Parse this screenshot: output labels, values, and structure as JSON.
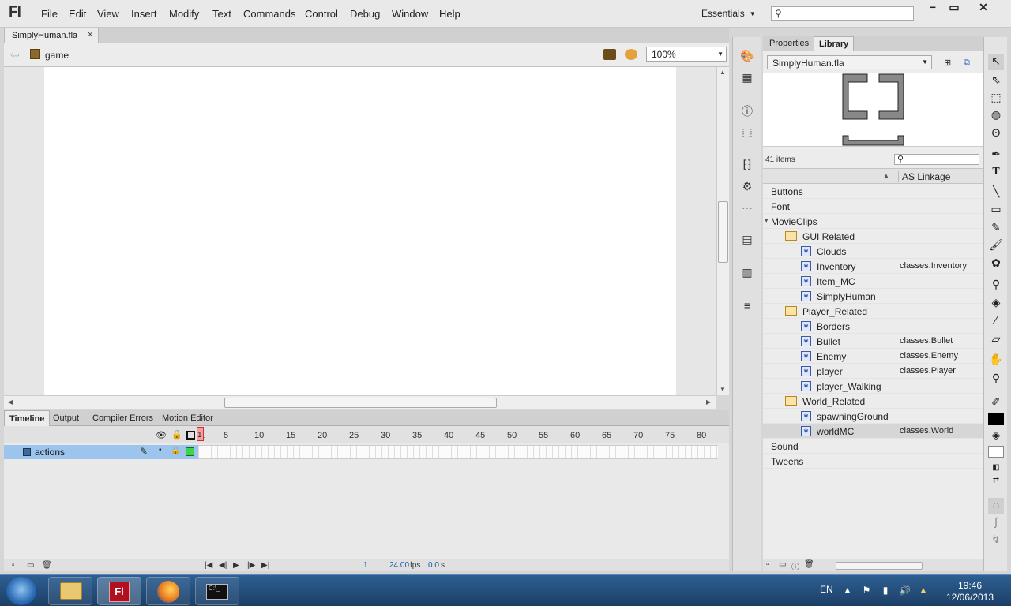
{
  "app": {
    "logo": "Fl",
    "menu": [
      "File",
      "Edit",
      "View",
      "Insert",
      "Modify",
      "Text",
      "Commands",
      "Control",
      "Debug",
      "Window",
      "Help"
    ],
    "workspace": "Essentials"
  },
  "document": {
    "tab_name": "SimplyHuman.fla",
    "close": "×",
    "scene": "game",
    "zoom": "100%"
  },
  "timeline": {
    "tabs": [
      "Timeline",
      "Output",
      "Compiler Errors",
      "Motion Editor"
    ],
    "frame_numbers": [
      "1",
      "5",
      "10",
      "15",
      "20",
      "25",
      "30",
      "35",
      "40",
      "45",
      "50",
      "55",
      "60",
      "65",
      "70",
      "75",
      "80"
    ],
    "layer": "actions",
    "current_frame": "1",
    "fps": "24.00",
    "fps_unit": "fps",
    "time": "0.0",
    "time_unit": "s"
  },
  "library": {
    "tabs": [
      "Properties",
      "Library"
    ],
    "file": "SimplyHuman.fla",
    "count": "41 items",
    "column": "AS Linkage",
    "items": [
      {
        "name": "Buttons",
        "level": 0,
        "type": "collapsed",
        "linkage": ""
      },
      {
        "name": "Font",
        "level": 0,
        "type": "collapsed",
        "linkage": ""
      },
      {
        "name": "MovieClips",
        "level": 0,
        "type": "expanded",
        "linkage": ""
      },
      {
        "name": "GUI Related",
        "level": 1,
        "type": "folder",
        "linkage": ""
      },
      {
        "name": "Clouds",
        "level": 2,
        "type": "movieclip",
        "linkage": ""
      },
      {
        "name": "Inventory",
        "level": 2,
        "type": "movieclip",
        "linkage": "classes.Inventory"
      },
      {
        "name": "Item_MC",
        "level": 2,
        "type": "movieclip",
        "linkage": ""
      },
      {
        "name": "SimplyHuman",
        "level": 2,
        "type": "movieclip",
        "linkage": ""
      },
      {
        "name": "Player_Related",
        "level": 1,
        "type": "folder",
        "linkage": ""
      },
      {
        "name": "Borders",
        "level": 2,
        "type": "movieclip",
        "linkage": ""
      },
      {
        "name": "Bullet",
        "level": 2,
        "type": "movieclip",
        "linkage": "classes.Bullet"
      },
      {
        "name": "Enemy",
        "level": 2,
        "type": "movieclip",
        "linkage": "classes.Enemy"
      },
      {
        "name": "player",
        "level": 2,
        "type": "movieclip",
        "linkage": "classes.Player"
      },
      {
        "name": "player_Walking",
        "level": 2,
        "type": "movieclip",
        "linkage": ""
      },
      {
        "name": "World_Related",
        "level": 1,
        "type": "folder",
        "linkage": ""
      },
      {
        "name": "spawningGround",
        "level": 2,
        "type": "movieclip",
        "linkage": ""
      },
      {
        "name": "worldMC",
        "level": 2,
        "type": "movieclip",
        "linkage": "classes.World",
        "selected": true
      },
      {
        "name": "Sound",
        "level": 0,
        "type": "collapsed",
        "linkage": ""
      },
      {
        "name": "Tweens",
        "level": 0,
        "type": "collapsed",
        "linkage": ""
      }
    ]
  },
  "taskbar": {
    "lang": "EN",
    "time": "19:46",
    "date": "12/06/2013"
  },
  "colors": {
    "layer_highlight": "#9cc4ec",
    "playhead": "#e03030",
    "flash_red": "#c8182c"
  }
}
